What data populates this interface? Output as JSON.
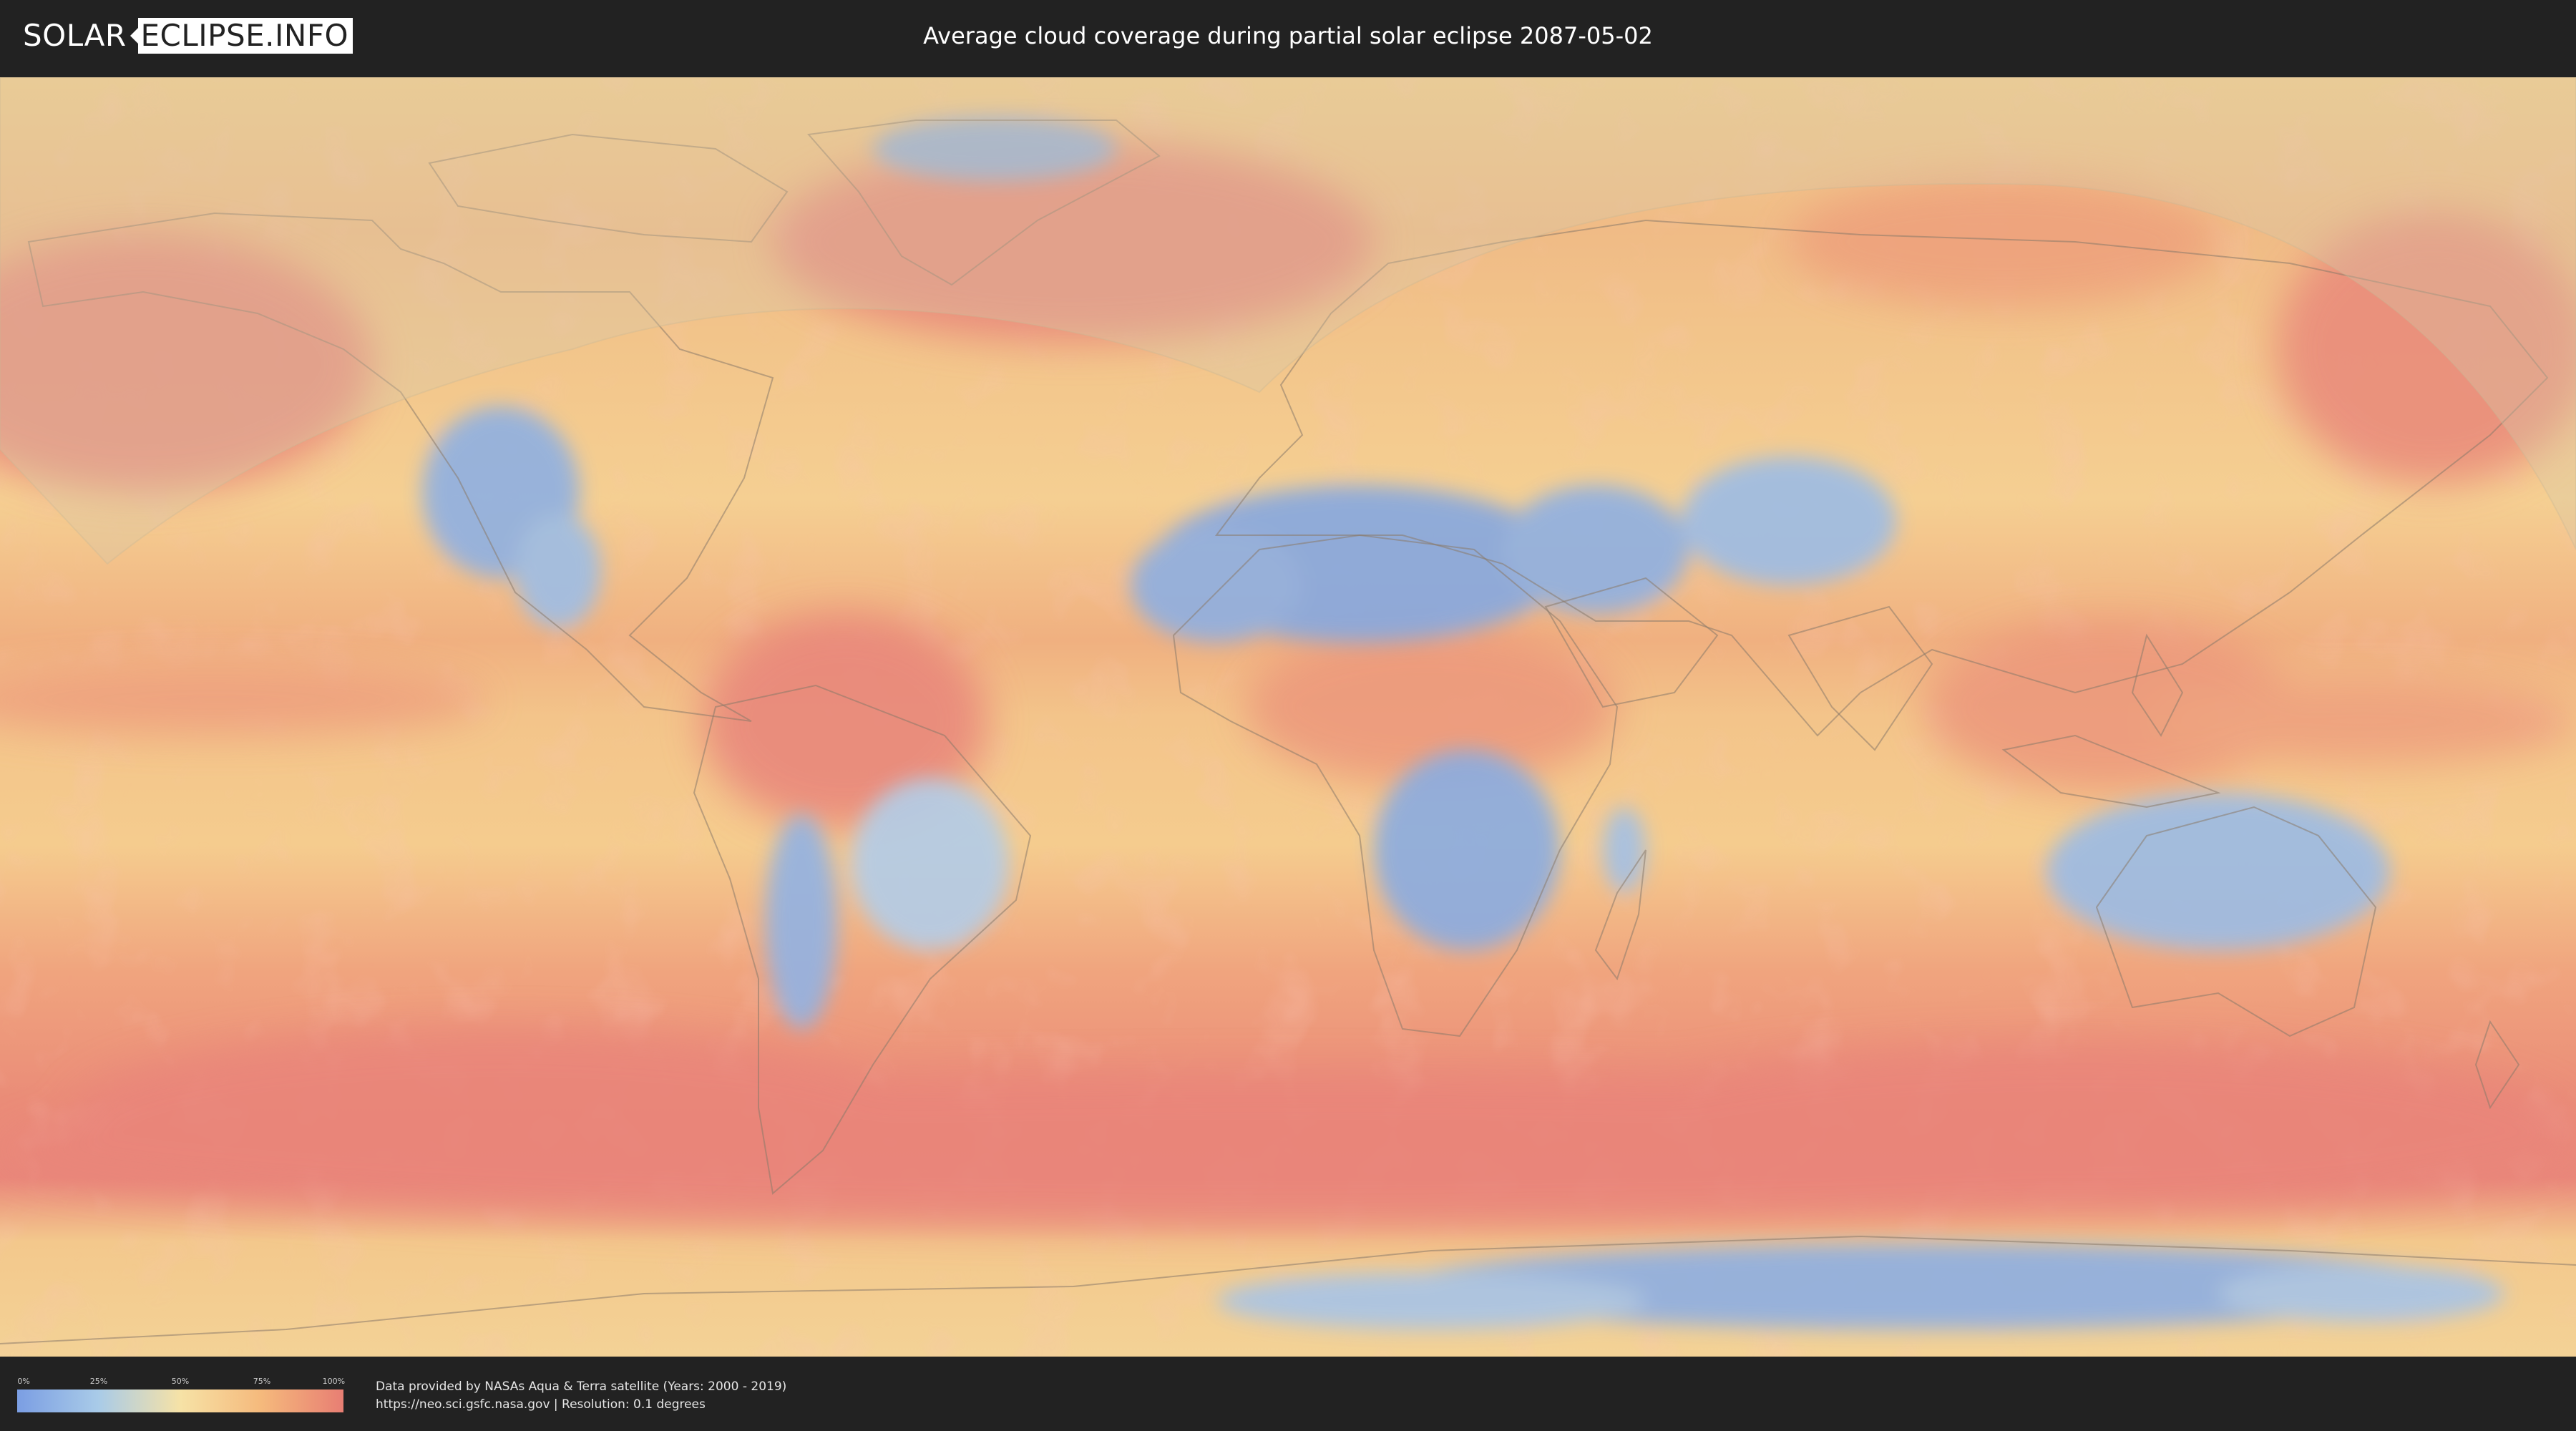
{
  "header": {
    "logo_left": "SOLAR",
    "logo_right": "ECLIPSE.INFO",
    "title": "Average cloud coverage during partial solar eclipse 2087-05-02"
  },
  "legend": {
    "ticks": [
      "0%",
      "25%",
      "50%",
      "75%",
      "100%"
    ],
    "colors": [
      "#7b9ee3",
      "#a9cbe8",
      "#f6e2a6",
      "#f5b97c",
      "#e87e73"
    ]
  },
  "footer": {
    "credit_line1": "Data provided by NASAs Aqua & Terra satellite (Years: 2000 - 2019)",
    "credit_line2": "https://neo.sci.gsfc.nasa.gov | Resolution: 0.1 degrees"
  },
  "map": {
    "cloud_cover_scale": "0% low (blue) to 100% high (red)",
    "eclipse_region_shading": "partial eclipse visibility overlay",
    "colors": {
      "ocean_base": "#f2c98a",
      "high_cloud": "#e8847a",
      "low_cloud": "#87a8e0",
      "coastline": "#8a7a6a"
    }
  }
}
